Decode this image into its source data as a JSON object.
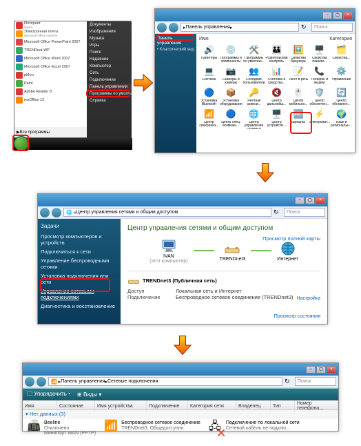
{
  "startmenu": {
    "items": [
      {
        "icon": "opera",
        "color": "#d33",
        "label": "Интернет",
        "sub": "Opera"
      },
      {
        "icon": "outlook",
        "color": "#f90",
        "label": "Электронная почта",
        "sub": "Microsoft Office Outlook"
      },
      {
        "icon": "ppt",
        "color": "#d44",
        "label": "Microsoft Office PowerPoint 2007",
        "sub": ""
      },
      {
        "icon": "trend",
        "color": "#3a6",
        "label": "TRENDnet WP",
        "sub": ""
      },
      {
        "icon": "word",
        "color": "#36c",
        "label": "Microsoft Office Word 2007",
        "sub": ""
      },
      {
        "icon": "excel",
        "color": "#2a7",
        "label": "Microsoft Office Excel 2007",
        "sub": ""
      },
      {
        "icon": "pmon",
        "color": "#d33",
        "label": "pMon",
        "sub": ""
      },
      {
        "icon": "paint",
        "color": "#4a4",
        "label": "Paint",
        "sub": ""
      },
      {
        "icon": "adobe",
        "color": "#d33",
        "label": "Adobe Reader 8",
        "sub": ""
      },
      {
        "icon": "office",
        "color": "#f80",
        "label": "msOffice 12",
        "sub": ""
      }
    ],
    "allprograms": "Все программы",
    "rightItems": [
      "Документы",
      "Изображения",
      "Музыка",
      "Игры",
      "Поиск",
      "Недавние",
      "Компьютер",
      "Сеть",
      "Подключение",
      "Панель управления",
      "Программы по умолчанию",
      "Справка"
    ],
    "cpanel_index": 9
  },
  "cpanel": {
    "addr": "Панель управления",
    "search": "Поиск",
    "side_header": "Панель управления",
    "side_link": "Классический вид",
    "view_label": "Имя",
    "view_value": "Категория",
    "icons": [
      {
        "g": "🔊",
        "c": "#3a7",
        "l": "Принтеры"
      },
      {
        "g": "💿",
        "c": "#69c",
        "l": "Программы и компоненты"
      },
      {
        "g": "🛠️",
        "c": "#888",
        "l": "Программы по умолчан..."
      },
      {
        "g": "👪",
        "c": "#3a7",
        "l": "Родительский контроль"
      },
      {
        "g": "🖼️",
        "c": "#69c",
        "l": "Свойства браузера"
      },
      {
        "g": "🖥️",
        "c": "#888",
        "l": "Свойства панели..."
      },
      {
        "g": "🗂️",
        "c": "#c96",
        "l": "Свойства..."
      },
      {
        "g": "💻",
        "c": "#555",
        "l": "Система"
      },
      {
        "g": "📷",
        "c": "#69c",
        "l": "Сканеры и камеры"
      },
      {
        "g": "👥",
        "c": "#3a7",
        "l": "Соседние пользователи"
      },
      {
        "g": "📊",
        "c": "#69c",
        "l": "Счетчики и средства..."
      },
      {
        "g": "📝",
        "c": "#888",
        "l": "Текст в речь"
      },
      {
        "g": "📞",
        "c": "#69c",
        "l": "Телефон и модем"
      },
      {
        "g": "⚙️",
        "c": "#888",
        "l": "Управление"
      },
      {
        "g": "🔵",
        "c": "#36c",
        "l": "Установка Bluetooth"
      },
      {
        "g": "📦",
        "c": "#c96",
        "l": "Установка оборудования"
      },
      {
        "g": "🔑",
        "c": "#7a3",
        "l": "Учетные записи..."
      },
      {
        "g": "🔇",
        "c": "#7a3",
        "l": "Центр дальнейш..."
      },
      {
        "g": "🖱️",
        "c": "#888",
        "l": "Центр мобильно..."
      },
      {
        "g": "🛡️",
        "c": "#393",
        "l": "Центр обеспечен..."
      },
      {
        "g": "🔄",
        "c": "#f90",
        "l": "Центр обновлен..."
      },
      {
        "g": "📶",
        "c": "#36c",
        "l": "Центр синхрониз..."
      },
      {
        "g": "🔵",
        "c": "#36c",
        "l": "Центр спец. возможн..."
      },
      {
        "g": "🌐",
        "c": "#3a7",
        "l": "Центр управления сетями и общи..."
      },
      {
        "g": "🖥️",
        "c": "#69c",
        "l": "Центр устройств..."
      },
      {
        "g": "🔤",
        "c": "#c96",
        "l": "Шрифты"
      },
      {
        "g": "⚡",
        "c": "#7a3",
        "l": "Электропит..."
      },
      {
        "g": "🌍",
        "c": "#69c",
        "l": "Язык и региональн..."
      }
    ],
    "network_index": 23
  },
  "nsc": {
    "addr": "Центр управления сетями и общим доступом",
    "search": "Поиск",
    "tasks_header": "Задачи",
    "tasks": [
      "Просмотр компьютеров и устройств",
      "Подключиться к сети",
      "Управление беспроводными сетями",
      "Установка подключения или сети",
      "Управление сетевыми подключениями",
      "Диагностика и восстановление"
    ],
    "active_task_index": 4,
    "title": "Центр управления сетями и общим доступом",
    "map_link": "Просмотр полной карты",
    "node_pc": "IVAN",
    "node_pc_sub": "(этот компьютер)",
    "node_router": "TRENDnet3",
    "node_internet": "Интернет",
    "network_name": "TRENDnet3 (Публичная сеть)",
    "setting_link": "Настройка",
    "row_access_k": "Доступ",
    "row_access_v": "Локальная сеть и Интернет",
    "row_conn_k": "Подключение",
    "row_conn_v": "Беспроводное сетевое соединение (TRENDnet3)",
    "view_status": "Просмотр состояния"
  },
  "nc": {
    "breadcrumb1": "Панель управления",
    "breadcrumb2": "Сетевые подключения",
    "search": "Поиск",
    "organize": "Упорядочить",
    "views": "Виды",
    "cols": [
      "Имя",
      "Состояние",
      "Имя устройства",
      "Подключение",
      "Категория сети",
      "Владелец",
      "Тип",
      "Номер телефона..."
    ],
    "group": "Нет данных (3)",
    "conns": [
      {
        "name": "Beeline",
        "status": "Отключено",
        "dev": "Минипорт WAN (PPTP)",
        "icon": "📠",
        "overlay": ""
      },
      {
        "name": "Беспроводное сетевое соединение",
        "status": "TRENDnet3, Общедоступно",
        "dev": "",
        "icon": "📶",
        "overlay": ""
      },
      {
        "name": "Подключение по локальной сети",
        "status": "Сетевой кабель не подклю...",
        "dev": "",
        "icon": "🖧",
        "overlay": "❌"
      }
    ]
  }
}
